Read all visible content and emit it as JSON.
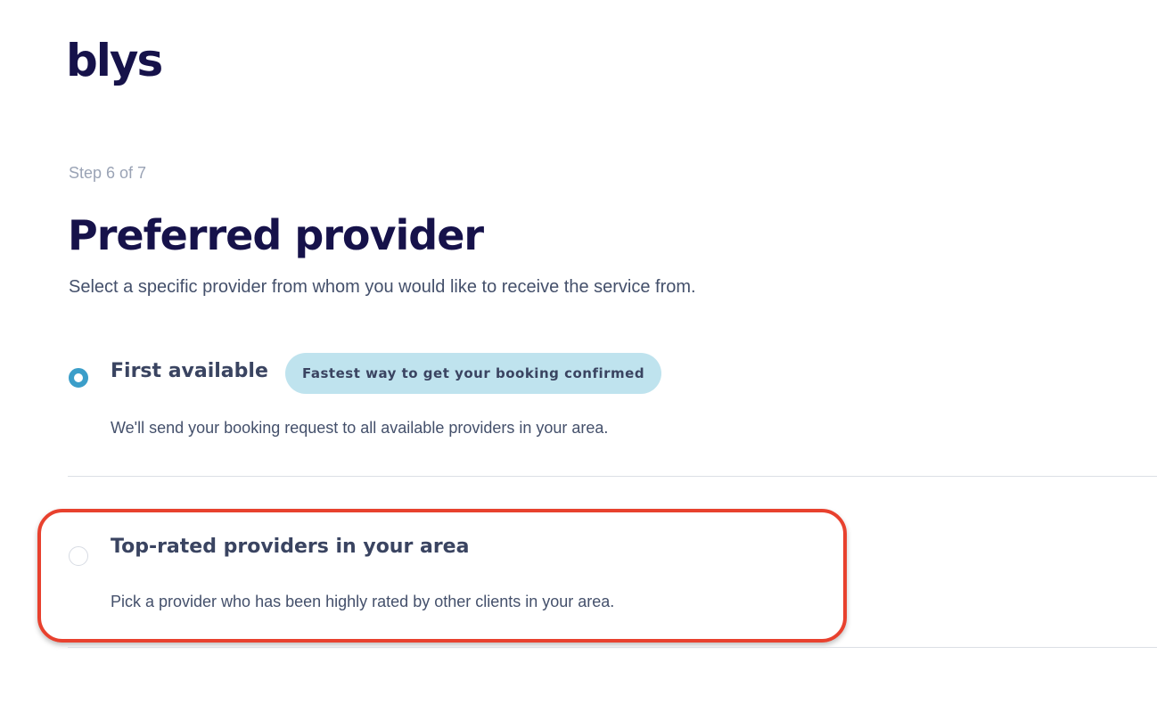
{
  "brand": {
    "logo_text": "blys"
  },
  "header": {
    "step": "Step 6 of 7",
    "title": "Preferred provider",
    "subtitle": "Select a specific provider from whom you would like to receive the service from."
  },
  "options": [
    {
      "title": "First available",
      "badge": "Fastest way to get your booking confirmed",
      "description": "We'll send your booking request to all available providers in your area.",
      "selected": true
    },
    {
      "title": "Top-rated providers in your area",
      "description": "Pick a provider who has been highly rated by other clients in your area.",
      "selected": false
    }
  ],
  "colors": {
    "accent": "#3b9ec9",
    "badge_bg": "#bfe3ee",
    "highlight": "#e8412e",
    "brand": "#16124a"
  }
}
